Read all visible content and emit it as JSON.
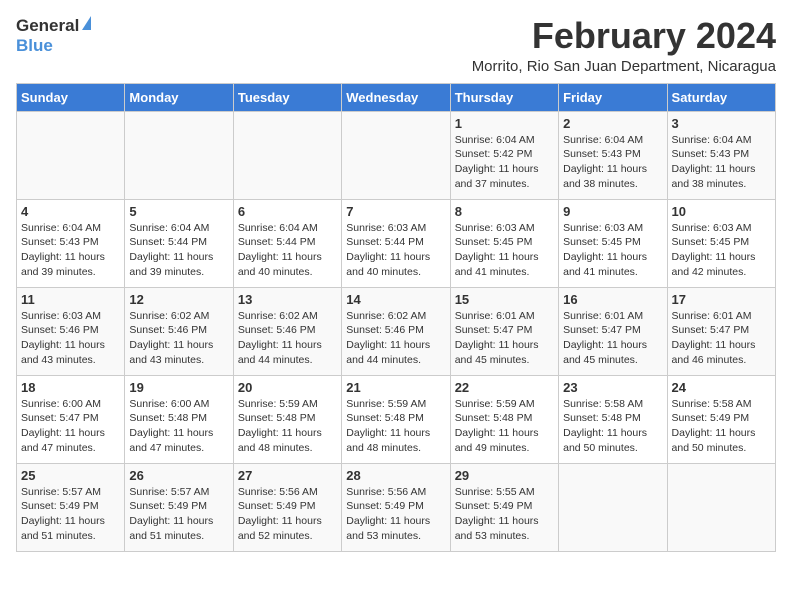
{
  "logo": {
    "general": "General",
    "blue": "Blue"
  },
  "title": "February 2024",
  "location": "Morrito, Rio San Juan Department, Nicaragua",
  "days_of_week": [
    "Sunday",
    "Monday",
    "Tuesday",
    "Wednesday",
    "Thursday",
    "Friday",
    "Saturday"
  ],
  "weeks": [
    [
      {
        "day": "",
        "info": ""
      },
      {
        "day": "",
        "info": ""
      },
      {
        "day": "",
        "info": ""
      },
      {
        "day": "",
        "info": ""
      },
      {
        "day": "1",
        "info": "Sunrise: 6:04 AM\nSunset: 5:42 PM\nDaylight: 11 hours\nand 37 minutes."
      },
      {
        "day": "2",
        "info": "Sunrise: 6:04 AM\nSunset: 5:43 PM\nDaylight: 11 hours\nand 38 minutes."
      },
      {
        "day": "3",
        "info": "Sunrise: 6:04 AM\nSunset: 5:43 PM\nDaylight: 11 hours\nand 38 minutes."
      }
    ],
    [
      {
        "day": "4",
        "info": "Sunrise: 6:04 AM\nSunset: 5:43 PM\nDaylight: 11 hours\nand 39 minutes."
      },
      {
        "day": "5",
        "info": "Sunrise: 6:04 AM\nSunset: 5:44 PM\nDaylight: 11 hours\nand 39 minutes."
      },
      {
        "day": "6",
        "info": "Sunrise: 6:04 AM\nSunset: 5:44 PM\nDaylight: 11 hours\nand 40 minutes."
      },
      {
        "day": "7",
        "info": "Sunrise: 6:03 AM\nSunset: 5:44 PM\nDaylight: 11 hours\nand 40 minutes."
      },
      {
        "day": "8",
        "info": "Sunrise: 6:03 AM\nSunset: 5:45 PM\nDaylight: 11 hours\nand 41 minutes."
      },
      {
        "day": "9",
        "info": "Sunrise: 6:03 AM\nSunset: 5:45 PM\nDaylight: 11 hours\nand 41 minutes."
      },
      {
        "day": "10",
        "info": "Sunrise: 6:03 AM\nSunset: 5:45 PM\nDaylight: 11 hours\nand 42 minutes."
      }
    ],
    [
      {
        "day": "11",
        "info": "Sunrise: 6:03 AM\nSunset: 5:46 PM\nDaylight: 11 hours\nand 43 minutes."
      },
      {
        "day": "12",
        "info": "Sunrise: 6:02 AM\nSunset: 5:46 PM\nDaylight: 11 hours\nand 43 minutes."
      },
      {
        "day": "13",
        "info": "Sunrise: 6:02 AM\nSunset: 5:46 PM\nDaylight: 11 hours\nand 44 minutes."
      },
      {
        "day": "14",
        "info": "Sunrise: 6:02 AM\nSunset: 5:46 PM\nDaylight: 11 hours\nand 44 minutes."
      },
      {
        "day": "15",
        "info": "Sunrise: 6:01 AM\nSunset: 5:47 PM\nDaylight: 11 hours\nand 45 minutes."
      },
      {
        "day": "16",
        "info": "Sunrise: 6:01 AM\nSunset: 5:47 PM\nDaylight: 11 hours\nand 45 minutes."
      },
      {
        "day": "17",
        "info": "Sunrise: 6:01 AM\nSunset: 5:47 PM\nDaylight: 11 hours\nand 46 minutes."
      }
    ],
    [
      {
        "day": "18",
        "info": "Sunrise: 6:00 AM\nSunset: 5:47 PM\nDaylight: 11 hours\nand 47 minutes."
      },
      {
        "day": "19",
        "info": "Sunrise: 6:00 AM\nSunset: 5:48 PM\nDaylight: 11 hours\nand 47 minutes."
      },
      {
        "day": "20",
        "info": "Sunrise: 5:59 AM\nSunset: 5:48 PM\nDaylight: 11 hours\nand 48 minutes."
      },
      {
        "day": "21",
        "info": "Sunrise: 5:59 AM\nSunset: 5:48 PM\nDaylight: 11 hours\nand 48 minutes."
      },
      {
        "day": "22",
        "info": "Sunrise: 5:59 AM\nSunset: 5:48 PM\nDaylight: 11 hours\nand 49 minutes."
      },
      {
        "day": "23",
        "info": "Sunrise: 5:58 AM\nSunset: 5:48 PM\nDaylight: 11 hours\nand 50 minutes."
      },
      {
        "day": "24",
        "info": "Sunrise: 5:58 AM\nSunset: 5:49 PM\nDaylight: 11 hours\nand 50 minutes."
      }
    ],
    [
      {
        "day": "25",
        "info": "Sunrise: 5:57 AM\nSunset: 5:49 PM\nDaylight: 11 hours\nand 51 minutes."
      },
      {
        "day": "26",
        "info": "Sunrise: 5:57 AM\nSunset: 5:49 PM\nDaylight: 11 hours\nand 51 minutes."
      },
      {
        "day": "27",
        "info": "Sunrise: 5:56 AM\nSunset: 5:49 PM\nDaylight: 11 hours\nand 52 minutes."
      },
      {
        "day": "28",
        "info": "Sunrise: 5:56 AM\nSunset: 5:49 PM\nDaylight: 11 hours\nand 53 minutes."
      },
      {
        "day": "29",
        "info": "Sunrise: 5:55 AM\nSunset: 5:49 PM\nDaylight: 11 hours\nand 53 minutes."
      },
      {
        "day": "",
        "info": ""
      },
      {
        "day": "",
        "info": ""
      }
    ]
  ]
}
